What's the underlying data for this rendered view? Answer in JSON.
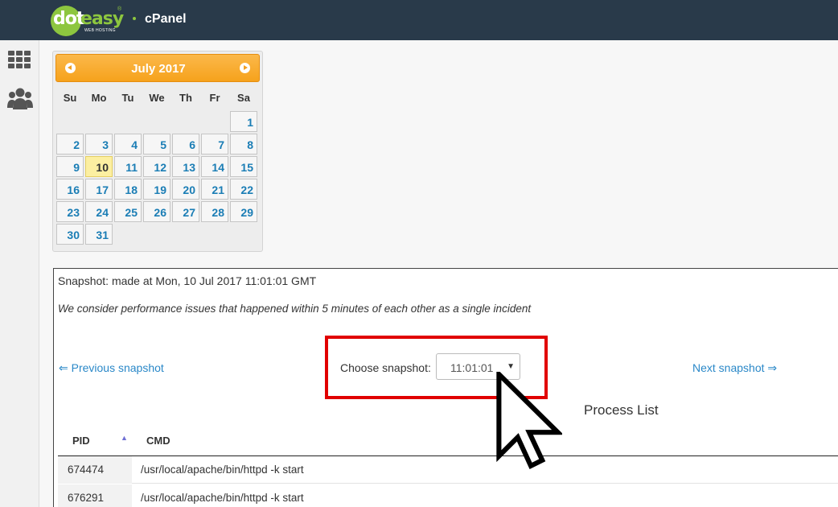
{
  "header": {
    "logo_dot": "dot",
    "logo_easy": "easy",
    "logo_reg": "®",
    "logo_sub": "WEB HOSTING",
    "product": "cPanel",
    "colors": {
      "bar": "#293a4a",
      "brand_green": "#8dc63f"
    }
  },
  "sidebar": {
    "icons": [
      "grid-icon",
      "users-icon"
    ]
  },
  "calendar": {
    "title": "July 2017",
    "prev_icon": "chevron-left-icon",
    "next_icon": "chevron-right-icon",
    "weekdays": [
      "Su",
      "Mo",
      "Tu",
      "We",
      "Th",
      "Fr",
      "Sa"
    ],
    "first_weekday_index": 6,
    "days": [
      "1",
      "2",
      "3",
      "4",
      "5",
      "6",
      "7",
      "8",
      "9",
      "10",
      "11",
      "12",
      "13",
      "14",
      "15",
      "16",
      "17",
      "18",
      "19",
      "20",
      "21",
      "22",
      "23",
      "24",
      "25",
      "26",
      "27",
      "28",
      "29",
      "30",
      "31"
    ],
    "selected_day": "10",
    "colors": {
      "header": "#f6a21c",
      "day_text": "#1a7db5",
      "today": "#fcefa1"
    }
  },
  "snapshot": {
    "made_at": "Snapshot: made at Mon, 10 Jul 2017 11:01:01 GMT",
    "note": "We consider performance issues that happened within 5 minutes of each other as a single incident",
    "prev_link": "⇐ Previous snapshot",
    "next_link": "Next snapshot ⇒",
    "choose_label": "Choose snapshot:",
    "selected_value": "11:01:01",
    "select_arrow": "▼"
  },
  "process_list": {
    "title": "Process List",
    "columns": {
      "pid": "PID",
      "sort_indicator": "▲",
      "cmd": "CMD"
    },
    "rows": [
      {
        "pid": "674474",
        "cmd": "/usr/local/apache/bin/httpd -k start"
      },
      {
        "pid": "676291",
        "cmd": "/usr/local/apache/bin/httpd -k start"
      }
    ]
  },
  "annotation": {
    "highlight_color": "#e10000",
    "cursor_icon": "mouse-pointer-icon"
  }
}
